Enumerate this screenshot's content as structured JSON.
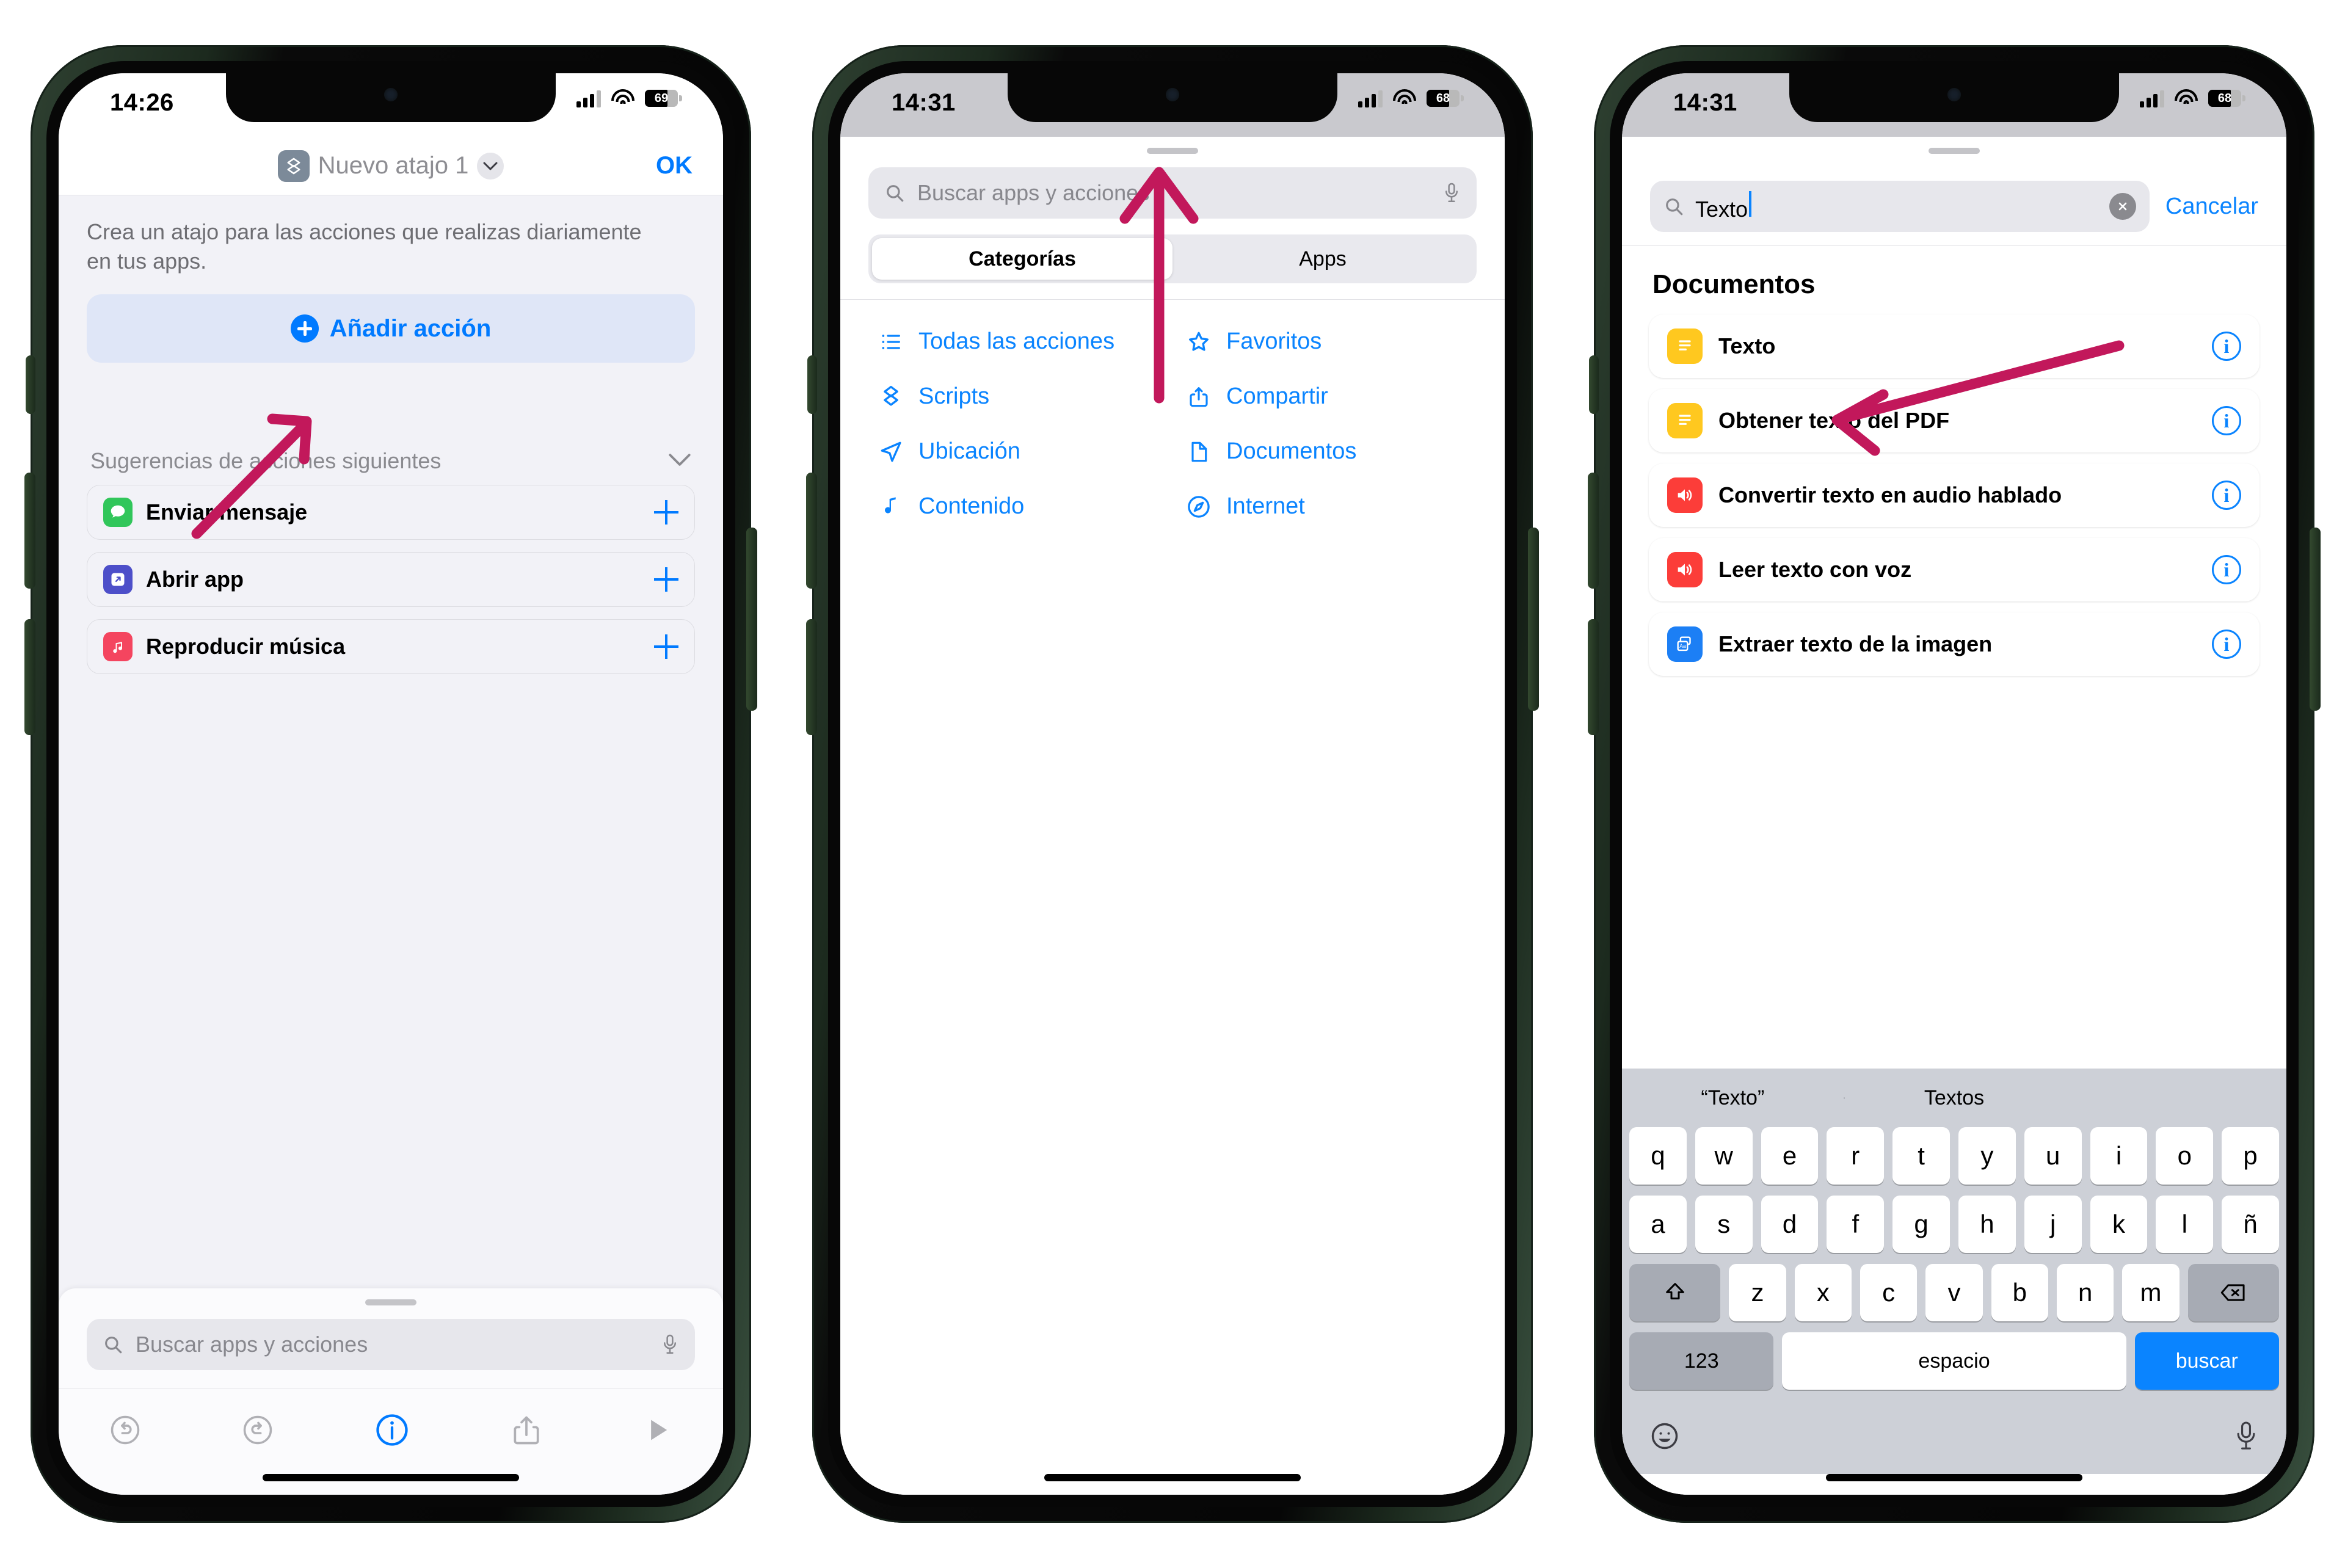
{
  "phone1": {
    "status": {
      "time": "14:26",
      "battery": "69"
    },
    "nav": {
      "title": "Nuevo atajo 1",
      "ok_label": "OK",
      "icon": "shortcuts-icon",
      "chevron": "chevron-down-icon"
    },
    "description": "Crea un atajo para las acciones que realizas diariamente en tus apps.",
    "add_action_label": "Añadir acción",
    "suggestions_header": "Sugerencias de acciones siguientes",
    "suggestions": [
      {
        "label": "Enviar mensaje",
        "icon": "messages-icon"
      },
      {
        "label": "Abrir app",
        "icon": "open-app-icon"
      },
      {
        "label": "Reproducir música",
        "icon": "music-icon"
      }
    ],
    "search": {
      "placeholder": "Buscar apps y acciones",
      "mic_icon": "microphone-icon"
    },
    "toolbar": [
      {
        "name": "undo-icon"
      },
      {
        "name": "redo-icon"
      },
      {
        "name": "info-icon"
      },
      {
        "name": "share-icon"
      },
      {
        "name": "play-icon"
      }
    ]
  },
  "phone2": {
    "status": {
      "time": "14:31",
      "battery": "68"
    },
    "search": {
      "placeholder": "Buscar apps y acciones",
      "mic_icon": "microphone-icon"
    },
    "segments": [
      {
        "label": "Categorías",
        "active": true
      },
      {
        "label": "Apps",
        "active": false
      }
    ],
    "categories": [
      {
        "label": "Todas las acciones",
        "icon": "list-icon"
      },
      {
        "label": "Favoritos",
        "icon": "star-icon"
      },
      {
        "label": "Scripts",
        "icon": "scripts-icon"
      },
      {
        "label": "Compartir",
        "icon": "share-icon"
      },
      {
        "label": "Ubicación",
        "icon": "location-arrow-icon"
      },
      {
        "label": "Documentos",
        "icon": "document-icon"
      },
      {
        "label": "Contenido",
        "icon": "music-note-icon"
      },
      {
        "label": "Internet",
        "icon": "safari-compass-icon"
      }
    ]
  },
  "phone3": {
    "status": {
      "time": "14:31",
      "battery": "68"
    },
    "search": {
      "value": "Texto",
      "clear_icon": "clear-circle-icon",
      "cancel_label": "Cancelar"
    },
    "section_title": "Documentos",
    "results": [
      {
        "label": "Texto",
        "icon": "text-document-icon",
        "icon_color": "#ffc81f"
      },
      {
        "label": "Obtener texto del PDF",
        "icon": "text-document-icon",
        "icon_color": "#ffc81f"
      },
      {
        "label": "Convertir texto en audio hablado",
        "icon": "speaker-icon",
        "icon_color": "#fc3d39"
      },
      {
        "label": "Leer texto con voz",
        "icon": "speaker-icon",
        "icon_color": "#fc3d39"
      },
      {
        "label": "Extraer texto de la imagen",
        "icon": "live-text-icon",
        "icon_color": "#1c7ff5"
      }
    ],
    "keyboard": {
      "suggestions": [
        "“Texto”",
        "Textos",
        ""
      ],
      "row1": [
        "q",
        "w",
        "e",
        "r",
        "t",
        "y",
        "u",
        "i",
        "o",
        "p"
      ],
      "row2": [
        "a",
        "s",
        "d",
        "f",
        "g",
        "h",
        "j",
        "k",
        "l",
        "ñ"
      ],
      "row3": [
        "z",
        "x",
        "c",
        "v",
        "b",
        "n",
        "m"
      ],
      "shift_icon": "shift-icon",
      "backspace_icon": "backspace-icon",
      "numbers_label": "123",
      "space_label": "espacio",
      "return_label": "buscar",
      "emoji_icon": "emoji-icon",
      "dictate_icon": "microphone-icon"
    }
  },
  "annotations": {
    "arrow_color": "#c2185b",
    "arrows": [
      {
        "name": "arrow-to-add-action"
      },
      {
        "name": "arrow-to-search-field"
      },
      {
        "name": "arrow-to-texto-result"
      }
    ]
  }
}
